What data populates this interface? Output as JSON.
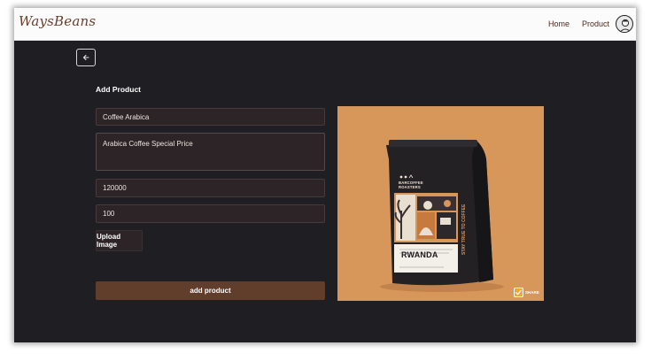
{
  "navbar": {
    "logo_text": "WaysBeans",
    "links": [
      {
        "label": "Home"
      },
      {
        "label": "Product"
      }
    ]
  },
  "form": {
    "title": "Add Product",
    "name_value": "Coffee Arabica",
    "description_value": "Arabica Coffee Special Price",
    "price_value": "120000",
    "stock_value": "100",
    "upload_label": "Upload Image",
    "submit_label": "add product"
  },
  "preview": {
    "brand": "BARCOFFEE ROASTERS",
    "origin": "RWANDA",
    "tagline": "STAY TRUE TO COFFEE",
    "badge": "SHARE"
  },
  "colors": {
    "page_bg": "#1f1e23",
    "navbar_bg": "#fbfbfb",
    "field_bg": "#2c2426",
    "button_brown": "#613d2b",
    "preview_bg": "#d8975a",
    "accent_orange": "#f2a436"
  },
  "icons": {
    "back": "arrow-left-icon",
    "avatar": "user-avatar-icon",
    "share": "share-check-icon"
  }
}
